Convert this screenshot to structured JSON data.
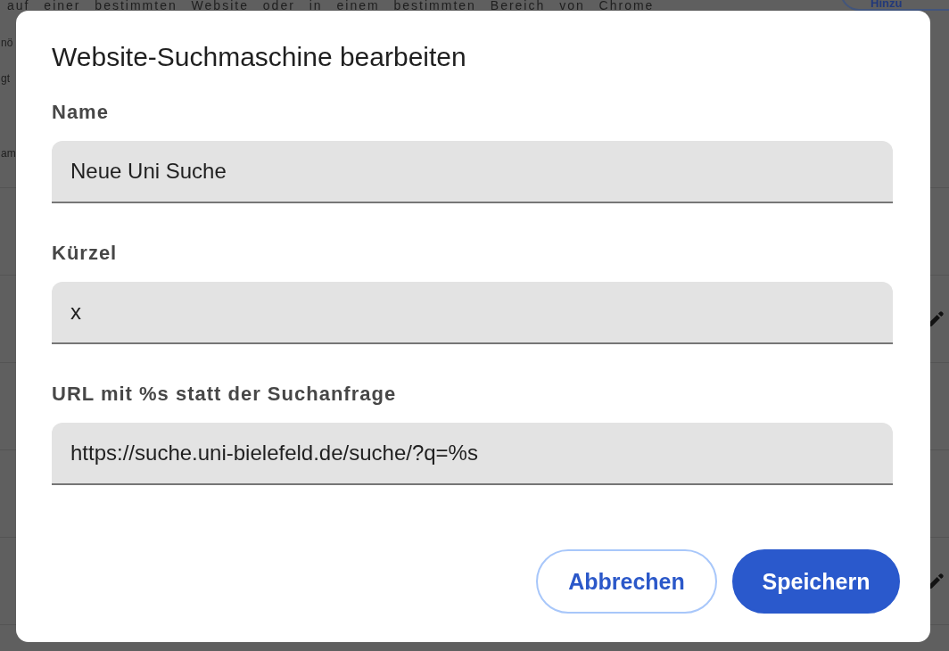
{
  "background_page": {
    "description_lines": [
      "auf einer bestimmten Website oder in einem bestimmten Bereich von Chrome",
      "nö",
      "gt"
    ],
    "add_button": "Hinzu",
    "list_header": "am",
    "rows": [
      {
        "kind": "plain"
      },
      {
        "kind": "editable"
      },
      {
        "kind": "plain"
      },
      {
        "kind": "plain"
      },
      {
        "kind": "editable"
      },
      {
        "kind": "plain"
      }
    ]
  },
  "dialog": {
    "title": "Website-Suchmaschine bearbeiten",
    "fields": [
      {
        "label": "Name",
        "value": "Neue Uni Suche"
      },
      {
        "label": "Kürzel",
        "value": "x"
      },
      {
        "label": "URL mit %s statt der Suchanfrage",
        "value": "https://suche.uni-bielefeld.de/suche/?q=%s"
      }
    ],
    "buttons": [
      {
        "label": "Abbrechen",
        "kind": "secondary"
      },
      {
        "label": "Speichern",
        "kind": "primary"
      }
    ]
  }
}
